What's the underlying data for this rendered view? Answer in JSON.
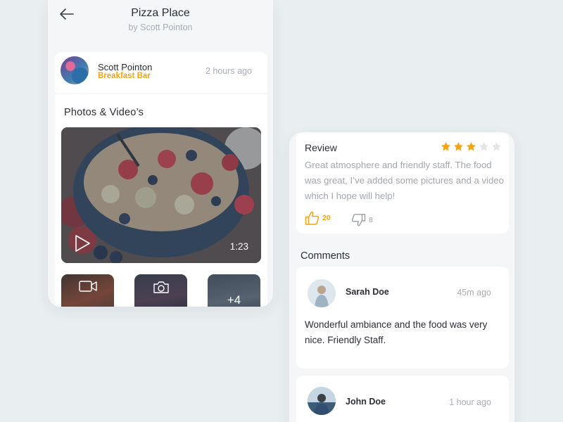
{
  "place": {
    "title": "Pizza Place",
    "subtitle": "by Scott Pointon"
  },
  "post": {
    "author_name": "Scott Pointon",
    "venue": "Breakfast Bar",
    "time": "2 hours ago"
  },
  "media": {
    "heading": "Photos & Video’s",
    "video_duration": "1:23",
    "more_count": "+4"
  },
  "review": {
    "title": "Review",
    "rating": 3,
    "max_rating": 5,
    "text": "Great atmosphere and friendly staff. The food was great, I’ve added some pictures and a video which I hope will help!",
    "likes": "20",
    "dislikes": "8"
  },
  "comments": {
    "heading": "Comments",
    "items": [
      {
        "name": "Sarah Doe",
        "time": "45m ago",
        "text": "Wonderful ambiance and the food was very nice. Friendly Staff."
      },
      {
        "name": "John Doe",
        "time": "1 hour ago"
      }
    ]
  },
  "colors": {
    "accent": "#f2a516",
    "star_empty": "#e3e6e9",
    "background": "#e9eef0",
    "card": "#ffffff",
    "text_primary": "#2b2f3a",
    "text_muted": "#a8adb6"
  },
  "icons": {
    "back": "arrow-left-icon",
    "play": "play-icon",
    "video": "video-camera-icon",
    "camera": "camera-icon",
    "like": "thumbs-up-icon",
    "dislike": "thumbs-down-icon",
    "star": "star-icon"
  }
}
